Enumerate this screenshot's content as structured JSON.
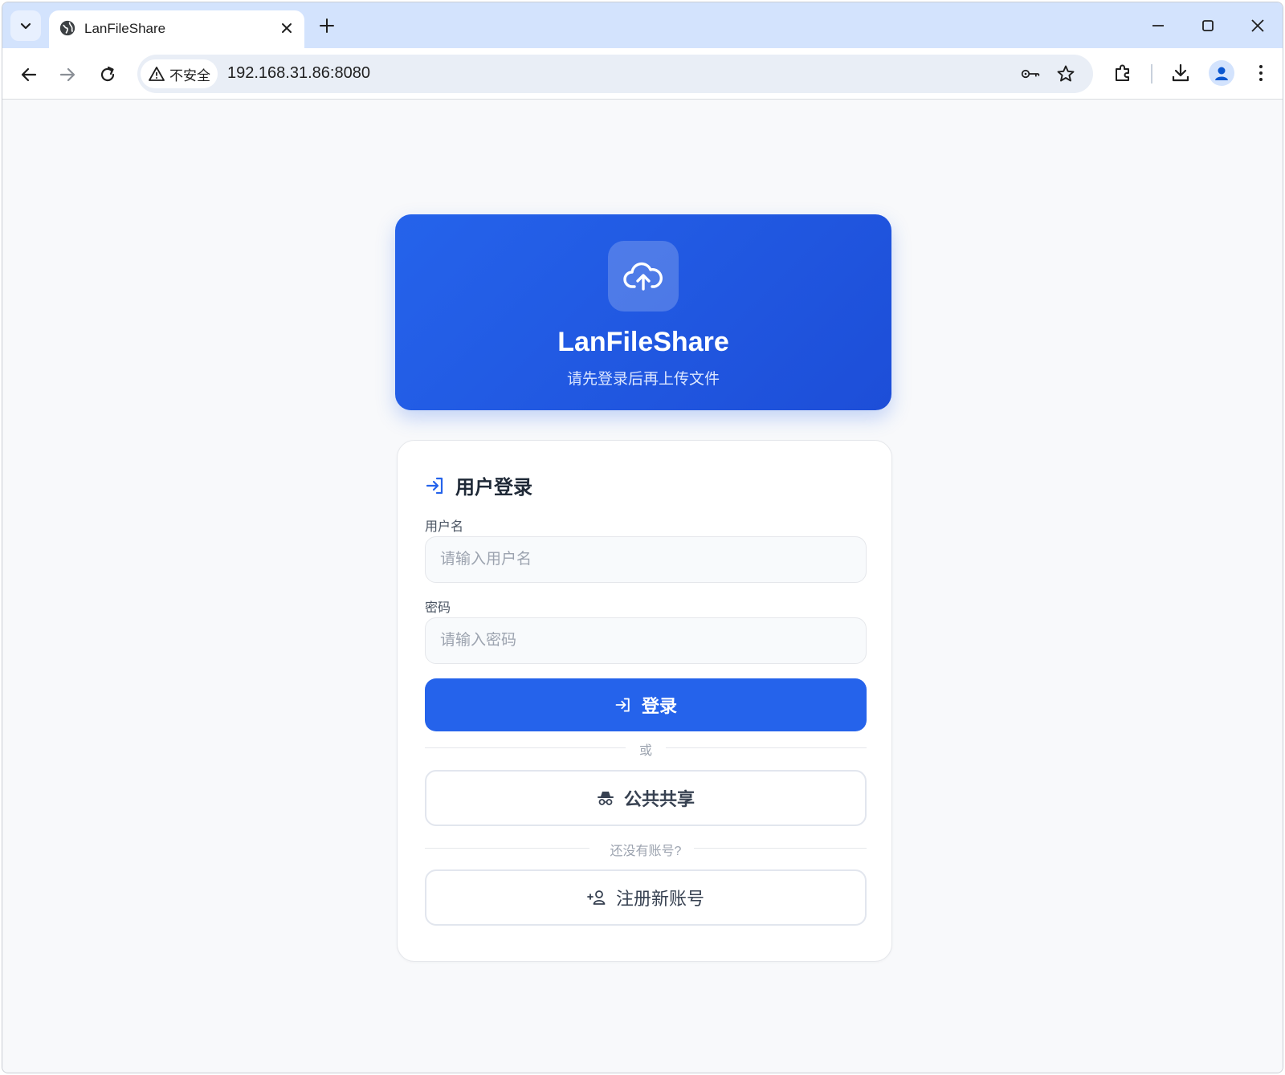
{
  "browser": {
    "tab_title": "LanFileShare",
    "security_label": "不安全",
    "url": "192.168.31.86:8080"
  },
  "hero": {
    "title": "LanFileShare",
    "subtitle": "请先登录后再上传文件",
    "icon": "cloud-upload-icon"
  },
  "login": {
    "heading": "用户登录",
    "username_label": "用户名",
    "username_placeholder": "请输入用户名",
    "password_label": "密码",
    "password_placeholder": "请输入密码",
    "submit_label": "登录",
    "or_label": "或",
    "public_share_label": "公共共享",
    "no_account_label": "还没有账号?",
    "register_label": "注册新账号"
  },
  "colors": {
    "accent": "#2563eb",
    "accent_dark": "#1d4ed8",
    "background": "#f8f9fb",
    "tabstrip": "#d3e3fd"
  }
}
